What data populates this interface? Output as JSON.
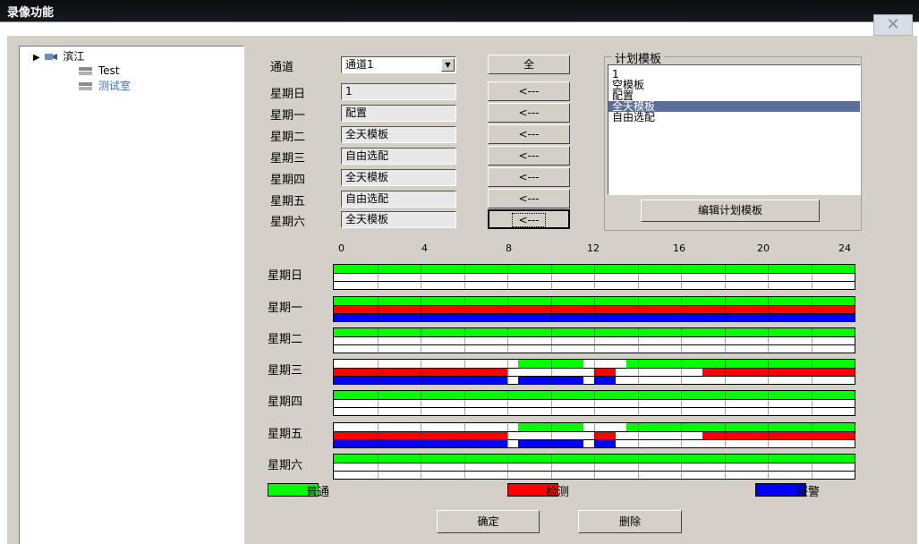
{
  "window": {
    "title": "录像功能",
    "close_glyph": "✕"
  },
  "tree": {
    "root": "滨江",
    "children": [
      "Test",
      "测试室"
    ]
  },
  "channel": {
    "label": "通道",
    "value": "通道1",
    "all_button": "全"
  },
  "days": [
    {
      "label": "星期日",
      "template": "1"
    },
    {
      "label": "星期一",
      "template": "配置"
    },
    {
      "label": "星期二",
      "template": "全天模板"
    },
    {
      "label": "星期三",
      "template": "自由选配"
    },
    {
      "label": "星期四",
      "template": "全天模板"
    },
    {
      "label": "星期五",
      "template": "自由选配"
    },
    {
      "label": "星期六",
      "template": "全天模板"
    }
  ],
  "apply_button": "<---",
  "plan": {
    "legend": "计划模板",
    "items": [
      "1",
      "空模板",
      "配置",
      "全天模板",
      "自由选配"
    ],
    "selected_index": 3,
    "edit_button": "编辑计划模板"
  },
  "timeline": {
    "ticks": [
      "0",
      "4",
      "8",
      "12",
      "16",
      "20",
      "24"
    ],
    "colors": {
      "normal": "#00ff00",
      "detect": "#ff0000",
      "alarm": "#0000ff"
    },
    "schedules": [
      {
        "day": "星期日",
        "rows": [
          [
            [
              0,
              24,
              "normal"
            ]
          ],
          [],
          []
        ]
      },
      {
        "day": "星期一",
        "rows": [
          [
            [
              0,
              24,
              "normal"
            ]
          ],
          [
            [
              0,
              24,
              "detect"
            ]
          ],
          [
            [
              0,
              24,
              "alarm"
            ]
          ]
        ]
      },
      {
        "day": "星期二",
        "rows": [
          [
            [
              0,
              24,
              "normal"
            ]
          ],
          [],
          []
        ]
      },
      {
        "day": "星期三",
        "rows": [
          [
            [
              8.5,
              11.5,
              "normal"
            ],
            [
              13.5,
              24,
              "normal"
            ]
          ],
          [
            [
              0,
              8,
              "detect"
            ],
            [
              12,
              13,
              "detect"
            ],
            [
              17,
              24,
              "detect"
            ]
          ],
          [
            [
              0,
              8,
              "alarm"
            ],
            [
              8.5,
              11.5,
              "alarm"
            ],
            [
              12,
              13,
              "alarm"
            ]
          ]
        ]
      },
      {
        "day": "星期四",
        "rows": [
          [
            [
              0,
              24,
              "normal"
            ]
          ],
          [],
          []
        ]
      },
      {
        "day": "星期五",
        "rows": [
          [
            [
              8.5,
              11.5,
              "normal"
            ],
            [
              13.5,
              24,
              "normal"
            ]
          ],
          [
            [
              0,
              8,
              "detect"
            ],
            [
              12,
              13,
              "detect"
            ],
            [
              17,
              24,
              "detect"
            ]
          ],
          [
            [
              0,
              8,
              "alarm"
            ],
            [
              8.5,
              11.5,
              "alarm"
            ],
            [
              12,
              13,
              "alarm"
            ]
          ]
        ]
      },
      {
        "day": "星期六",
        "rows": [
          [
            [
              0,
              24,
              "normal"
            ]
          ],
          [],
          []
        ]
      }
    ]
  },
  "legend": {
    "normal": "普通",
    "detect": "检测",
    "alarm": "报警"
  },
  "footer": {
    "ok": "确定",
    "delete": "删除"
  }
}
